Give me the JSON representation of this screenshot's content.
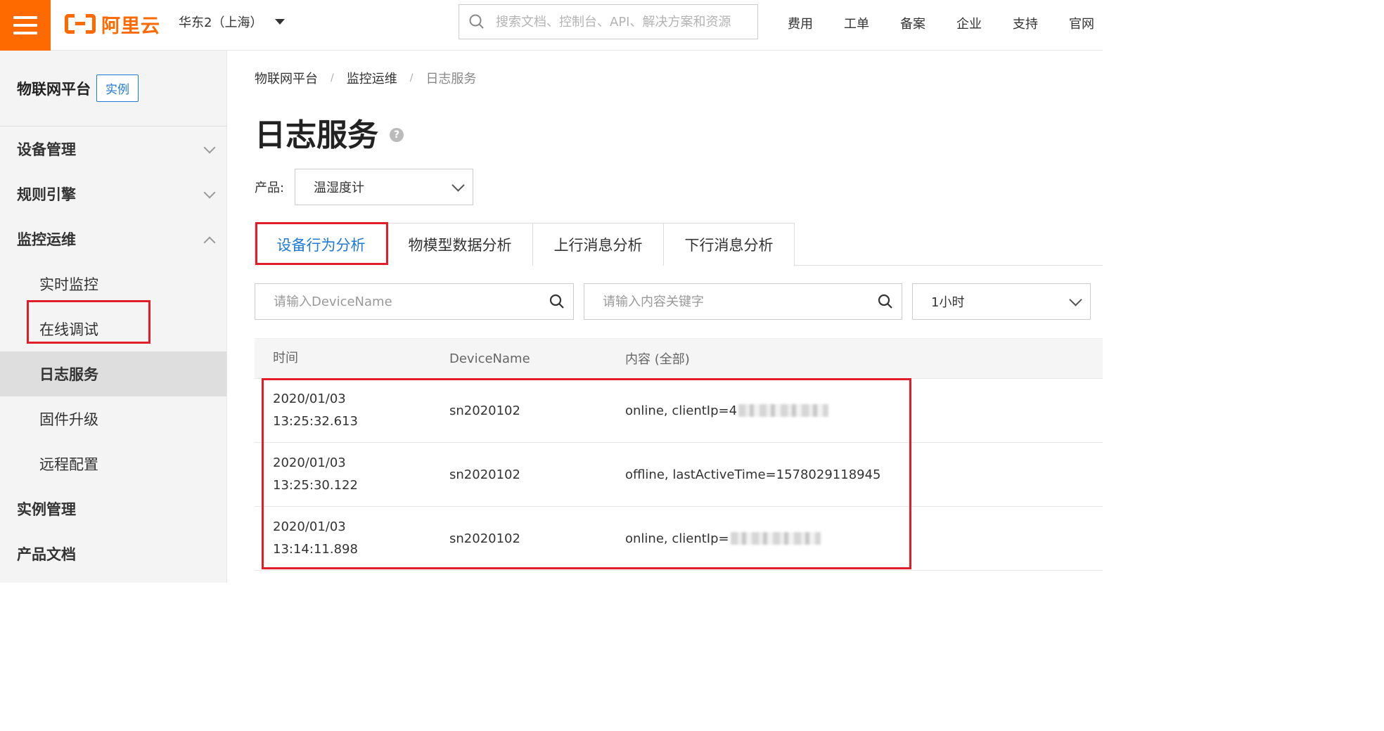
{
  "header": {
    "logo_text": "阿里云",
    "region": "华东2（上海）",
    "search_placeholder": "搜索文档、控制台、API、解决方案和资源",
    "nav": [
      "费用",
      "工单",
      "备案",
      "企业",
      "支持",
      "官网"
    ]
  },
  "sidebar": {
    "title": "物联网平台",
    "badge": "实例",
    "items": [
      {
        "label": "设备管理"
      },
      {
        "label": "规则引擎"
      },
      {
        "label": "监控运维"
      },
      {
        "label": "实时监控"
      },
      {
        "label": "在线调试"
      },
      {
        "label": "日志服务"
      },
      {
        "label": "固件升级"
      },
      {
        "label": "远程配置"
      },
      {
        "label": "实例管理"
      },
      {
        "label": "产品文档"
      }
    ]
  },
  "breadcrumb": {
    "items": [
      "物联网平台",
      "监控运维",
      "日志服务"
    ],
    "separator": "/"
  },
  "page": {
    "title": "日志服务",
    "help_icon": "?"
  },
  "product": {
    "label": "产品:",
    "selected": "温湿度计"
  },
  "tabs": [
    "设备行为分析",
    "物模型数据分析",
    "上行消息分析",
    "下行消息分析"
  ],
  "filters": {
    "device_placeholder": "请输入DeviceName",
    "keyword_placeholder": "请输入内容关键字",
    "time_range": "1小时"
  },
  "table": {
    "headers": [
      "时间",
      "DeviceName",
      "内容 (全部)"
    ],
    "rows": [
      {
        "date": "2020/01/03",
        "time": "13:25:32.613",
        "device": "sn2020102",
        "content": "online, clientIp=4"
      },
      {
        "date": "2020/01/03",
        "time": "13:25:30.122",
        "device": "sn2020102",
        "content": "offline, lastActiveTime=1578029118945"
      },
      {
        "date": "2020/01/03",
        "time": "13:14:11.898",
        "device": "sn2020102",
        "content": "online, clientIp="
      }
    ]
  },
  "colors": {
    "brand": "#ff6a00",
    "link": "#1f7ad6",
    "highlight": "#e11d2a"
  }
}
